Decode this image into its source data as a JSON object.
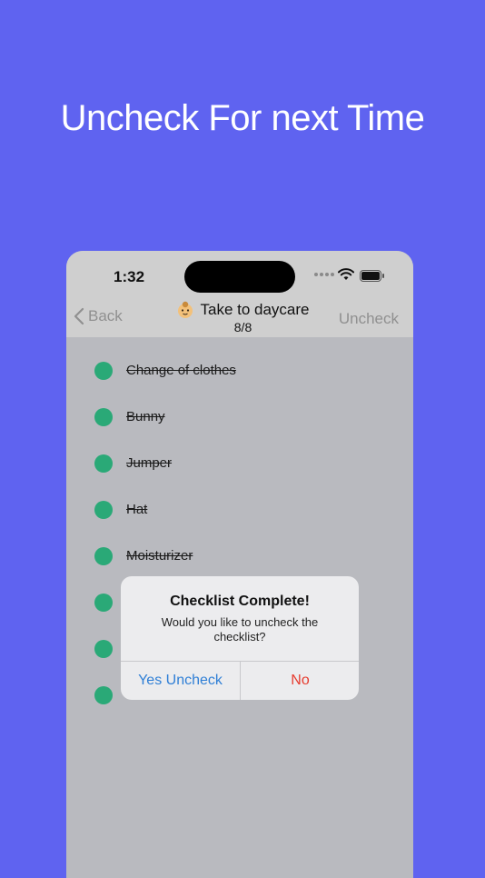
{
  "promo": {
    "headline": "Uncheck For next Time"
  },
  "status_bar": {
    "time": "1:32"
  },
  "nav": {
    "back_label": "Back",
    "title": "Take to daycare",
    "title_icon": "baby-face-emoji",
    "count": "8/8",
    "uncheck_label": "Uncheck"
  },
  "checklist": {
    "items": [
      {
        "label": "Change of clothes",
        "checked": true
      },
      {
        "label": "Bunny",
        "checked": true
      },
      {
        "label": "Jumper",
        "checked": true
      },
      {
        "label": "Hat",
        "checked": true
      },
      {
        "label": "Moisturizer",
        "checked": true
      },
      {
        "label": "",
        "checked": true
      },
      {
        "label": "",
        "checked": true
      },
      {
        "label": "",
        "checked": true
      }
    ]
  },
  "alert": {
    "title": "Checklist Complete!",
    "message": "Would you like to uncheck the checklist?",
    "yes_label": "Yes Uncheck",
    "no_label": "No"
  },
  "colors": {
    "background": "#5f63f0",
    "checked_dot": "#2aa977",
    "link_blue": "#2f7fd6",
    "destructive_red": "#e63b2e"
  }
}
